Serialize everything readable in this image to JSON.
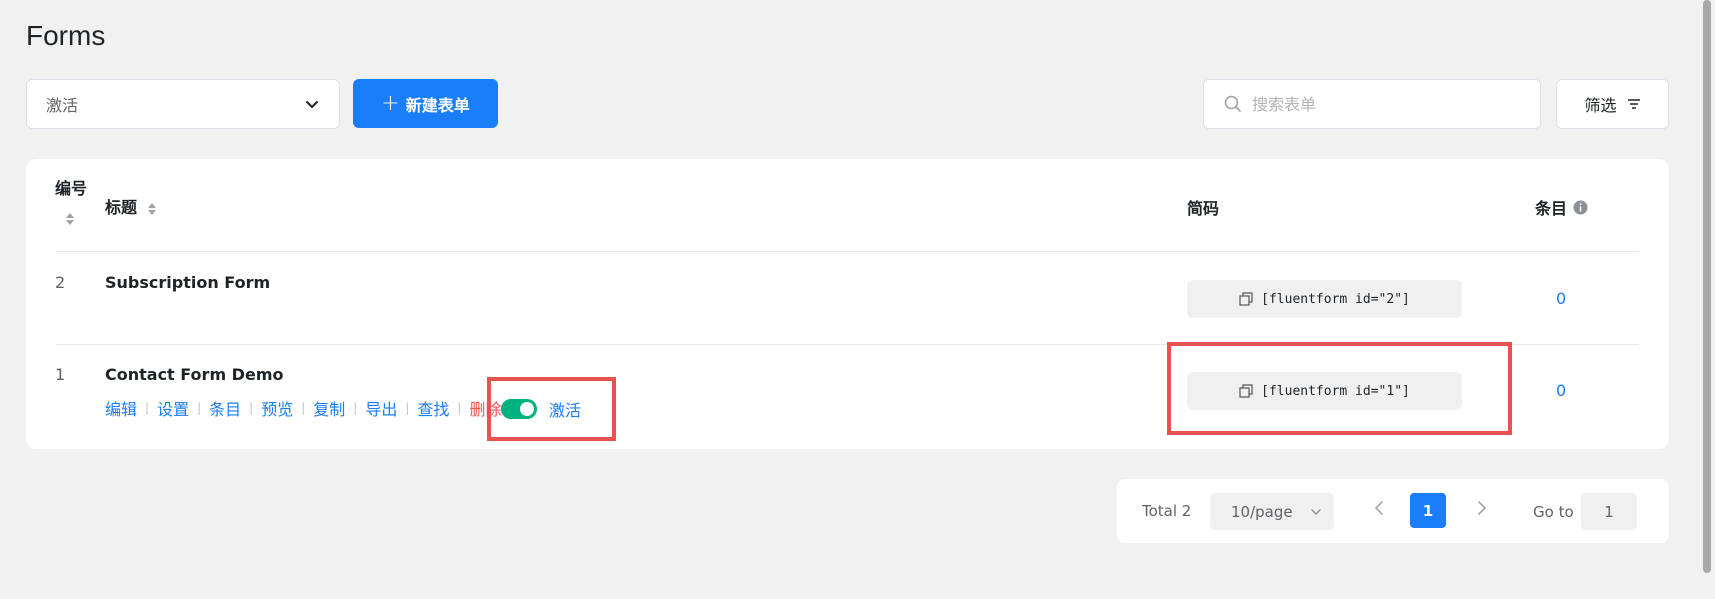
{
  "page": {
    "title": "Forms"
  },
  "toolbar": {
    "status_selected": "激活",
    "new_form_label": "新建表单",
    "search_placeholder": "搜索表单",
    "filter_label": "筛选"
  },
  "table": {
    "headers": {
      "id": "编号",
      "title": "标题",
      "shortcode": "简码",
      "entries": "条目"
    },
    "rows": [
      {
        "id": "2",
        "title": "Subscription Form",
        "shortcode": "[fluentform id=\"2\"]",
        "entries": "0"
      },
      {
        "id": "1",
        "title": "Contact Form Demo",
        "shortcode": "[fluentform id=\"1\"]",
        "entries": "0"
      }
    ],
    "row_actions": [
      "编辑",
      "设置",
      "条目",
      "预览",
      "复制",
      "导出",
      "查找",
      "删除"
    ],
    "status_label": "激活"
  },
  "pagination": {
    "total_label": "Total 2",
    "page_size": "10/page",
    "current_page": "1",
    "goto_label": "Go to",
    "goto_value": "1"
  },
  "colors": {
    "accent": "#1a7efb",
    "toggle_on": "#00b27f",
    "danger": "#ef5350",
    "highlight": "#e8534f"
  }
}
